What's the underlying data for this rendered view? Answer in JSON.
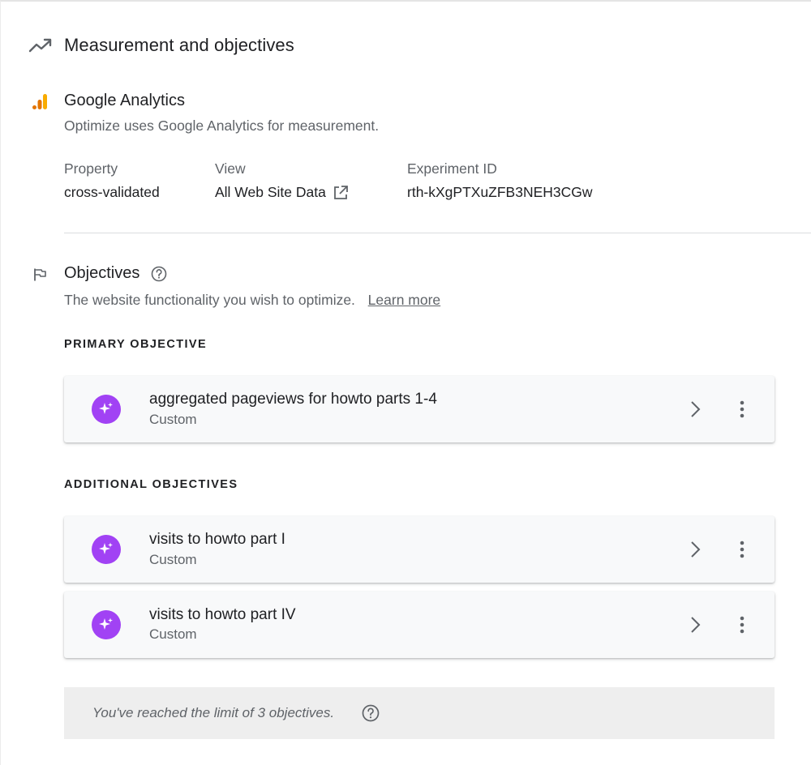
{
  "measurement": {
    "title": "Measurement and objectives",
    "icon": "trending-up-icon"
  },
  "analytics": {
    "title": "Google Analytics",
    "icon": "analytics-bars-icon",
    "description": "Optimize uses Google Analytics for measurement.",
    "property_label": "Property",
    "property_value": "cross-validated",
    "view_label": "View",
    "view_value": "All Web Site Data",
    "experiment_id_label": "Experiment ID",
    "experiment_id_value": "rth-kXgPTXuZFB3NEH3CGw"
  },
  "objectives": {
    "title": "Objectives",
    "icon": "flag-icon",
    "description": "The website functionality you wish to optimize.",
    "learn_more": "Learn more",
    "primary_header": "PRIMARY OBJECTIVE",
    "additional_header": "ADDITIONAL OBJECTIVES",
    "primary": {
      "name": "aggregated pageviews for howto parts 1-4",
      "type": "Custom"
    },
    "additional": [
      {
        "name": "visits to howto part I",
        "type": "Custom"
      },
      {
        "name": "visits to howto part IV",
        "type": "Custom"
      }
    ],
    "limit_notice": "You've reached the limit of 3 objectives."
  },
  "colors": {
    "accent_purple": "#a142f4",
    "analytics_orange": "#f9ab00",
    "analytics_dark_orange": "#e37400"
  }
}
